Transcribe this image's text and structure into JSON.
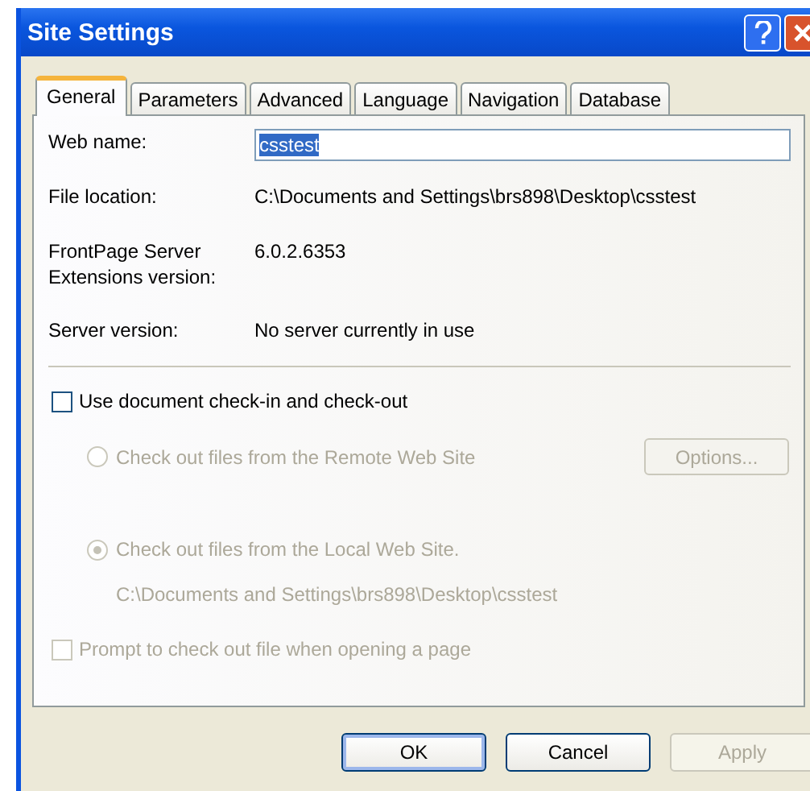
{
  "window": {
    "title": "Site Settings"
  },
  "tabs": [
    {
      "label": "General",
      "selected": true
    },
    {
      "label": "Parameters",
      "selected": false
    },
    {
      "label": "Advanced",
      "selected": false
    },
    {
      "label": "Language",
      "selected": false
    },
    {
      "label": "Navigation",
      "selected": false
    },
    {
      "label": "Database",
      "selected": false
    }
  ],
  "fields": [
    {
      "kind": "input",
      "label": "Web name:",
      "value": "csstest",
      "value_selected": true
    },
    {
      "kind": "text",
      "label": "File location:",
      "value": "C:\\Documents and Settings\\brs898\\Desktop\\csstest"
    },
    {
      "kind": "text",
      "label": "FrontPage Server Extensions version:",
      "value": "6.0.2.6353"
    },
    {
      "kind": "text",
      "label": "Server version:",
      "value": "No server currently in use"
    }
  ],
  "check_in": {
    "label": "Use document check-in and check-out",
    "checked": false
  },
  "options": [
    {
      "label": "Check out files from the Remote Web Site",
      "selected": false,
      "disabled": true
    },
    {
      "label": "Check out files from the Local Web Site.",
      "selected": true,
      "disabled": true,
      "path": "C:\\Documents and Settings\\brs898\\Desktop\\csstest"
    }
  ],
  "options_button": {
    "label": "Options...",
    "disabled": true
  },
  "prompt": {
    "label": "Prompt to check out file when opening a page",
    "checked": false,
    "disabled": true
  },
  "buttons": [
    {
      "label": "OK",
      "default": true,
      "disabled": false
    },
    {
      "label": "Cancel",
      "default": false,
      "disabled": false
    },
    {
      "label": "Apply",
      "default": false,
      "disabled": true
    }
  ]
}
